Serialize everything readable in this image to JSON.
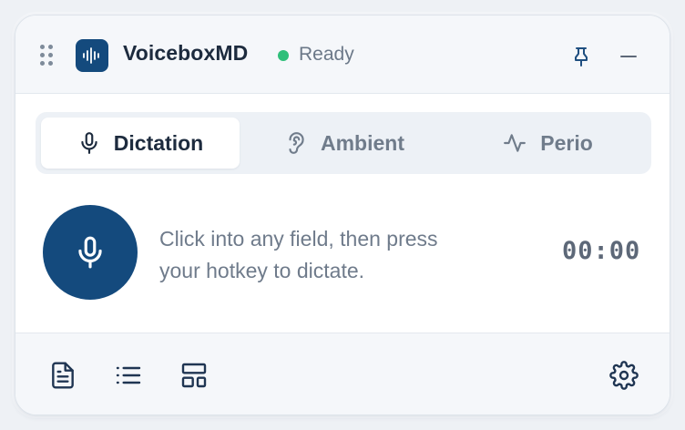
{
  "app": {
    "title": "VoiceboxMD",
    "status": "Ready",
    "status_color": "#2fbf7a",
    "brand_color": "#144a7d",
    "logo_icon": "audio-waveform-icon"
  },
  "header": {
    "drag_icon": "drag-handle-icon",
    "pin_icon": "pin-icon",
    "minimize_icon": "minimize-icon"
  },
  "tabs": [
    {
      "label": "Dictation",
      "icon": "microphone-icon",
      "active": true
    },
    {
      "label": "Ambient",
      "icon": "ear-icon",
      "active": false
    },
    {
      "label": "Perio",
      "icon": "activity-icon",
      "active": false
    }
  ],
  "main": {
    "record_icon": "microphone-icon",
    "hint_line1": "Click into any field, then press",
    "hint_line2": "your hotkey to dictate.",
    "timer": "00:00"
  },
  "footer": {
    "buttons": [
      {
        "icon": "document-icon"
      },
      {
        "icon": "list-icon"
      },
      {
        "icon": "layout-icon"
      },
      {
        "icon": "settings-icon"
      }
    ]
  }
}
